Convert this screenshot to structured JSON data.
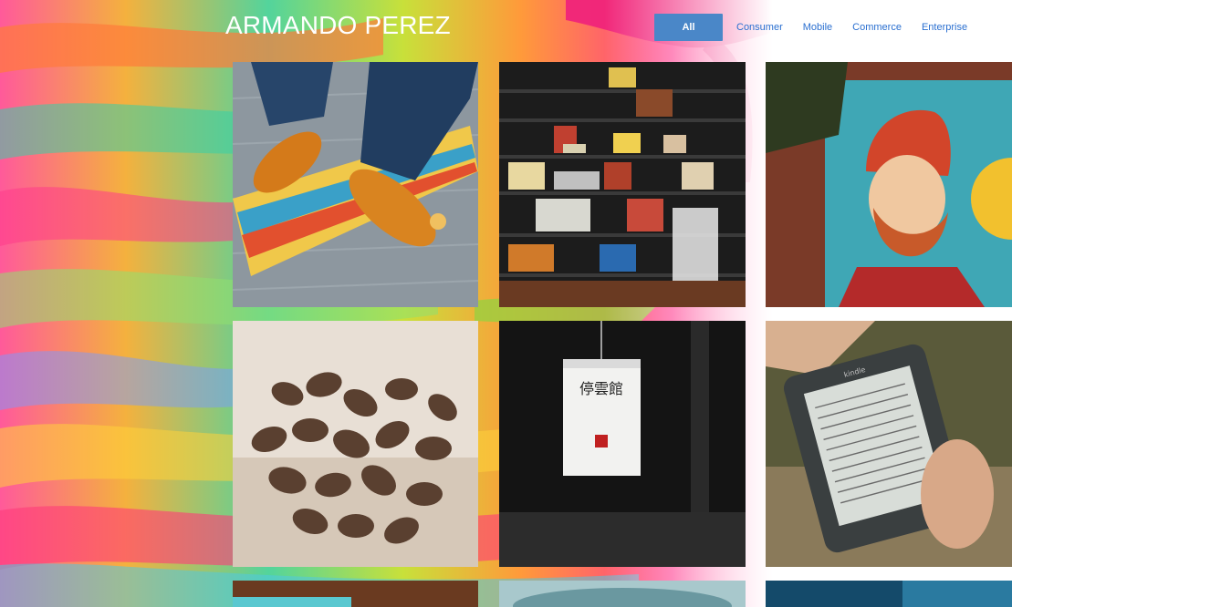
{
  "site": {
    "brand": "ARMANDO PEREZ"
  },
  "filters": [
    {
      "label": "All",
      "active": true
    },
    {
      "label": "Consumer",
      "active": false
    },
    {
      "label": "Mobile",
      "active": false
    },
    {
      "label": "Commerce",
      "active": false
    },
    {
      "label": "Enterprise",
      "active": false
    }
  ],
  "gallery": {
    "items": [
      {
        "subject": "orange shoes on a skateboard"
      },
      {
        "subject": "bookshelf with records and books"
      },
      {
        "subject": "mural of a bearded man in a red beanie"
      },
      {
        "subject": "coffee beans on wood"
      },
      {
        "subject": "paper lantern with calligraphy"
      },
      {
        "subject": "hand holding an e-reader"
      },
      {
        "subject": "laptop screen"
      },
      {
        "subject": "blurred teal photo"
      },
      {
        "subject": "blue photo"
      }
    ],
    "lantern_text": "停雲館",
    "ereader_brand": "kindle"
  },
  "colors": {
    "accent": "#4a87c8",
    "link": "#2a6fd0",
    "brand_text": "#ffffff"
  }
}
